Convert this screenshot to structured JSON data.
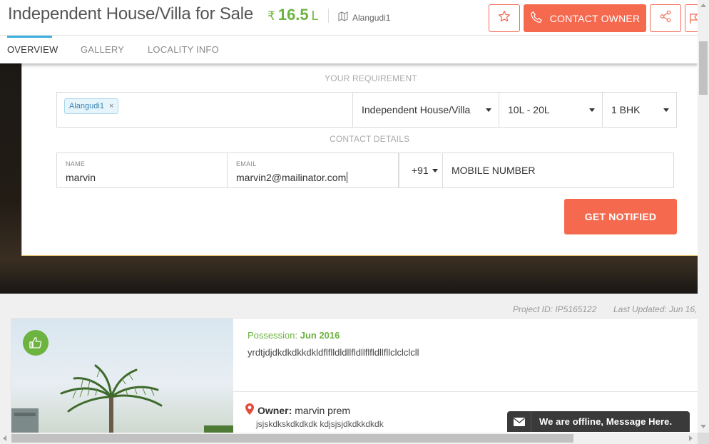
{
  "header": {
    "title": "Independent House/Villa for Sale",
    "currency_symbol": "₹",
    "price": "16.5",
    "price_unit": "L",
    "location": "Alangudi1",
    "contact_label": "CONTACT OWNER",
    "accent_color": "#f5694f",
    "price_color": "#6cb33f"
  },
  "tabs": [
    {
      "label": "OVERVIEW",
      "active": true
    },
    {
      "label": "GALLERY",
      "active": false
    },
    {
      "label": "LOCALITY INFO",
      "active": false
    }
  ],
  "form": {
    "requirement_heading": "YOUR REQUIREMENT",
    "location_tag": "Alangudi1",
    "tag_remove": "×",
    "property_type": "Independent House/Villa",
    "budget": "10L - 20L",
    "bedrooms": "1 BHK",
    "contact_heading": "CONTACT DETAILS",
    "name_label": "NAME",
    "name_value": "marvin",
    "email_label": "EMAIL",
    "email_value": "marvin2@mailinator.com",
    "country_code": "+91",
    "mobile_placeholder": "MOBILE NUMBER",
    "submit_label": "GET NOTIFIED"
  },
  "meta": {
    "project_id": "Project ID: IP5165122",
    "last_updated": "Last Updated: Jun 16,"
  },
  "listing": {
    "possession_label": "Possession:",
    "possession_value": "Jun 2016",
    "description": "yrdtjdjdkdkdkkdkldflflldldllfldllflfldllfllclclclcll",
    "owner_label": "Owner:",
    "owner_name": "marvin prem",
    "owner_description": "jsjskdkskdkdkdk kdjsjsjdkdkkdkdk"
  },
  "chat": {
    "label": "We are offline, Message Here."
  }
}
